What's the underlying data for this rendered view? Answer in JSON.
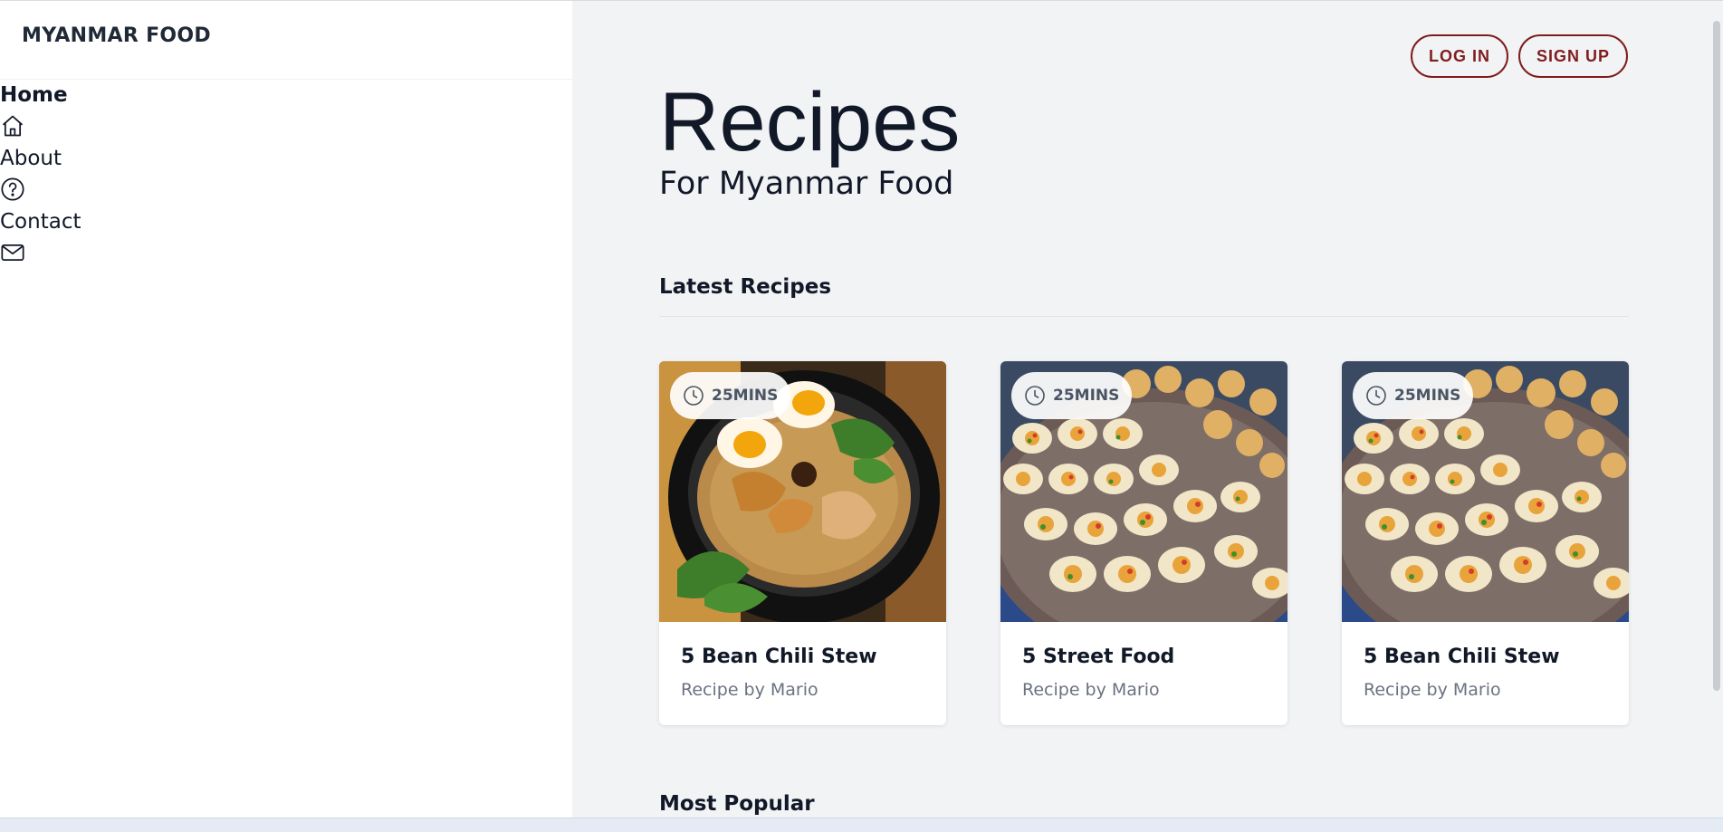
{
  "sidebar": {
    "brand": "MYANMAR FOOD",
    "items": [
      {
        "label": "Home",
        "icon": "home-icon",
        "active": true
      },
      {
        "label": "About",
        "icon": "help-circle-icon",
        "active": false
      },
      {
        "label": "Contact",
        "icon": "mail-icon",
        "active": false
      }
    ]
  },
  "header": {
    "login_label": "LOG IN",
    "signup_label": "SIGN UP"
  },
  "hero": {
    "title": "Recipes",
    "subtitle": "For Myanmar Food"
  },
  "sections": {
    "latest_title": "Latest Recipes",
    "popular_title": "Most Popular"
  },
  "recipes": [
    {
      "time": "25MINS",
      "title": "5 Bean Chili Stew",
      "author": "Recipe by Mario",
      "image": "noodle-soup-bowl"
    },
    {
      "time": "25MINS",
      "title": "5 Street Food",
      "author": "Recipe by Mario",
      "image": "street-food-tray"
    },
    {
      "time": "25MINS",
      "title": "5 Bean Chili Stew",
      "author": "Recipe by Mario",
      "image": "street-food-tray"
    }
  ],
  "colors": {
    "accent": "#7f1d1d",
    "main_bg": "#f2f3f5",
    "text": "#111827",
    "muted": "#6b7280"
  }
}
